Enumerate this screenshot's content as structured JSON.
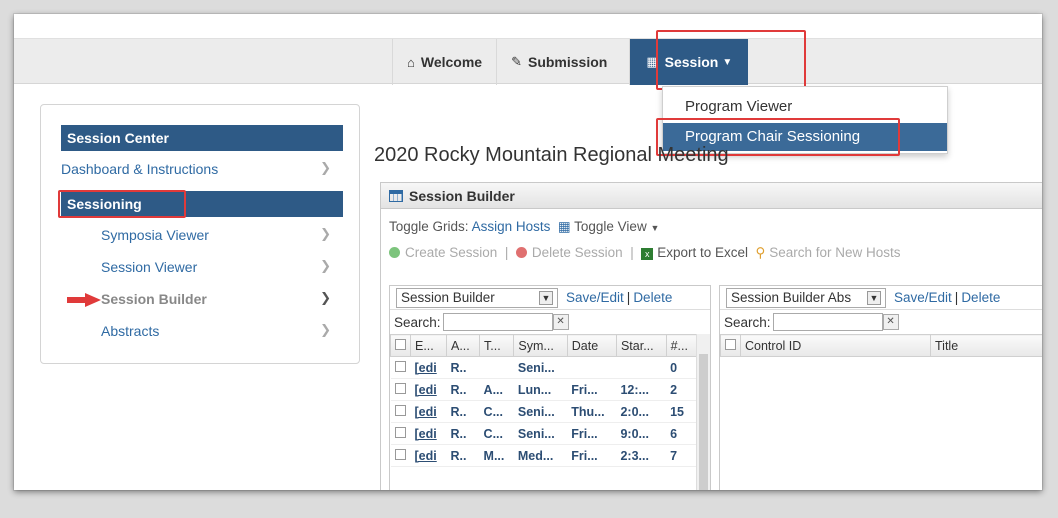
{
  "nav": {
    "welcome": "Welcome",
    "submission": "Submission",
    "session": "Session"
  },
  "dropdown": {
    "items": [
      "Program Viewer",
      "Program Chair Sessioning"
    ]
  },
  "sidebar": {
    "header": "Session Center",
    "dashboard": "Dashboard & Instructions",
    "sessioning": "Sessioning",
    "symposia": "Symposia Viewer",
    "session_viewer": "Session Viewer",
    "session_builder": "Session Builder",
    "abstracts": "Abstracts"
  },
  "page_title": "2020 Rocky Mountain Regional Meeting",
  "builder": {
    "title": "Session Builder",
    "toggle_grids_label": "Toggle Grids:",
    "assign_hosts": "Assign Hosts",
    "toggle_view": "Toggle View",
    "create_session": "Create Session",
    "delete_session": "Delete Session",
    "export_excel": "Export to Excel",
    "search_hosts": "Search for New Hosts",
    "left_panel": {
      "select": "Session Builder",
      "save_edit": "Save/Edit",
      "delete": "Delete",
      "search": "Search:",
      "columns": [
        "E...",
        "A...",
        "T...",
        "Sym...",
        "Date",
        "Star...",
        "#..."
      ],
      "rows": [
        [
          "[edi",
          "R..",
          "",
          "Seni...",
          "",
          "",
          "0"
        ],
        [
          "[edi",
          "R..",
          "A...",
          "Lun...",
          "Fri...",
          "12:...",
          "2"
        ],
        [
          "[edi",
          "R..",
          "C...",
          "Seni...",
          "Thu...",
          "2:0...",
          "15"
        ],
        [
          "[edi",
          "R..",
          "C...",
          "Seni...",
          "Fri...",
          "9:0...",
          "6"
        ],
        [
          "[edi",
          "R..",
          "M...",
          "Med...",
          "Fri...",
          "2:3...",
          "7"
        ]
      ]
    },
    "right_panel": {
      "select": "Session Builder Abs",
      "save_edit": "Save/Edit",
      "delete": "Delete",
      "search": "Search:",
      "columns": [
        "Control ID",
        "Title"
      ]
    }
  },
  "colors": {
    "primary": "#2e5a86",
    "link": "#2f6aa3",
    "highlight": "#e03a3a"
  }
}
